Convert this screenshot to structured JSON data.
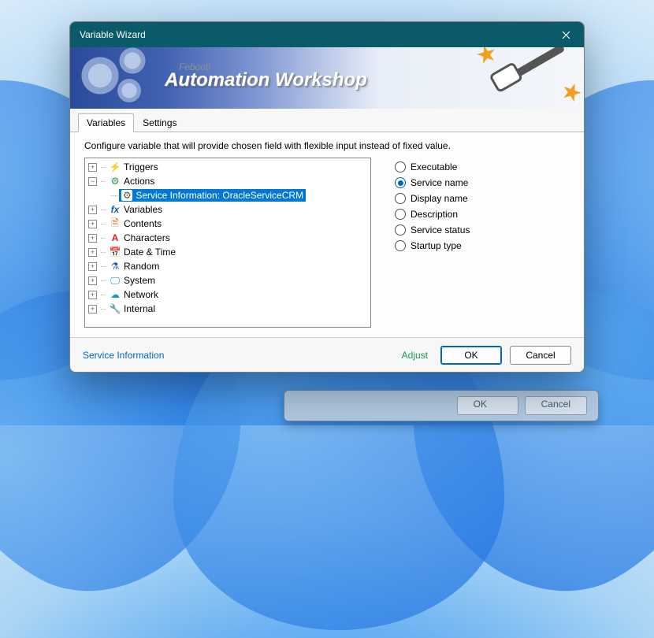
{
  "titlebar": {
    "title": "Variable Wizard"
  },
  "banner": {
    "sub": "Febooti",
    "title": "Automation Workshop"
  },
  "tabs": {
    "variables": "Variables",
    "settings": "Settings"
  },
  "description": "Configure variable that will provide chosen field with flexible input instead of fixed value.",
  "tree": {
    "triggers": "Triggers",
    "actions": "Actions",
    "action_child": "Service Information: OracleServiceCRM",
    "variables": "Variables",
    "contents": "Contents",
    "characters": "Characters",
    "datetime": "Date & Time",
    "random": "Random",
    "system": "System",
    "network": "Network",
    "internal": "Internal"
  },
  "radios": {
    "executable": "Executable",
    "service_name": "Service name",
    "display_name": "Display name",
    "description": "Description",
    "service_status": "Service status",
    "startup_type": "Startup type"
  },
  "footer": {
    "link": "Service Information",
    "adjust": "Adjust",
    "ok": "OK",
    "cancel": "Cancel"
  },
  "shadow": {
    "ok": "OK",
    "cancel": "Cancel"
  }
}
